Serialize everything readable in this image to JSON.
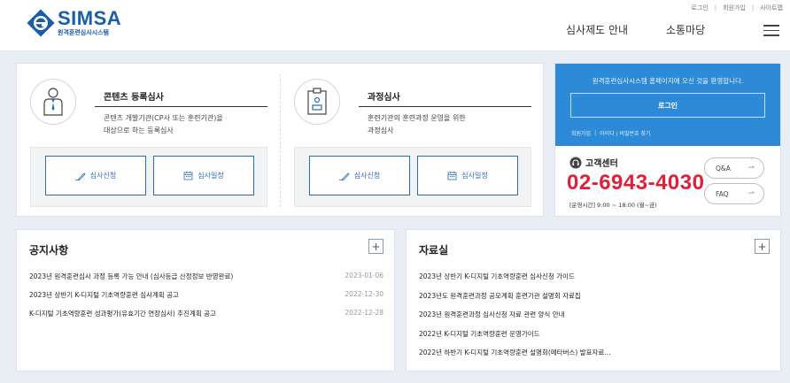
{
  "header": {
    "logo_text": "SIMSA",
    "logo_sub": "원격훈련심사시스템",
    "util_links": [
      "로그인",
      "회원가입",
      "사이트맵"
    ],
    "nav": [
      "심사제도 안내",
      "소통마당"
    ],
    "menu_icon": "hamburger-menu-icon"
  },
  "services": [
    {
      "title": "콘텐츠 등록심사",
      "desc_line1": "콘텐츠 개발기관(CP사 또는 훈련기관)을",
      "desc_line2": "대상으로 하는 등록심사",
      "icon": "person-tie-icon",
      "apply_label": "심사신청",
      "schedule_label": "심사일정"
    },
    {
      "title": "과정심사",
      "desc_line1": "훈련기관의 훈련과정 운영을 위한",
      "desc_line2": "과정심사",
      "icon": "clipboard-icon",
      "apply_label": "심사신청",
      "schedule_label": "심사일정"
    }
  ],
  "login": {
    "welcome": "원격훈련심사시스템 홈페이지에 오신 것을 환영합니다.",
    "login_label": "로그인",
    "links": [
      "회원가입",
      "아이디 / 비밀번호 찾기"
    ]
  },
  "customer_center": {
    "title": "고객센터",
    "phone": "02-6943-4030",
    "hours": "[운영시간] 9:00 ~ 18:00 (월~금)",
    "qna_label": "Q&A",
    "faq_label": "FAQ"
  },
  "notice": {
    "title": "공지사항",
    "more": "+",
    "items": [
      {
        "title": "2023년 원격훈련심사 과정 등록 가능 안내 (심사등급 산정정보 반영완료)",
        "date": "2023-01-06"
      },
      {
        "title": "2023년 상반기 K-디지털 기초역량훈련 심사계획 공고",
        "date": "2022-12-30"
      },
      {
        "title": "K-디지털 기초역량훈련 성과평가(유효기간 연장심사) 추진계획 공고",
        "date": "2022-12-28"
      }
    ]
  },
  "archive": {
    "title": "자료실",
    "more": "+",
    "items": [
      {
        "title": "2023년 상반기 K-디지털 기초역량훈련 심사신청 가이드"
      },
      {
        "title": "2023년도 원격훈련과정 공모계획 훈련기관 설명회 자료집"
      },
      {
        "title": "2023년 원격훈련과정 심사신청 자료 관련 양식 안내"
      },
      {
        "title": "2022년 K-디지털 기초역량훈련 운영가이드"
      },
      {
        "title": "2022년 하반기 K-디지털 기초역량훈련 설명회(메타버스) 발표자료..."
      }
    ]
  },
  "colors": {
    "brand_blue": "#1a5ea8",
    "button_blue": "#2b6cb0",
    "login_bg": "#2d8ad6",
    "phone_red": "#e0203a",
    "band_bg": "#e8eef4"
  }
}
